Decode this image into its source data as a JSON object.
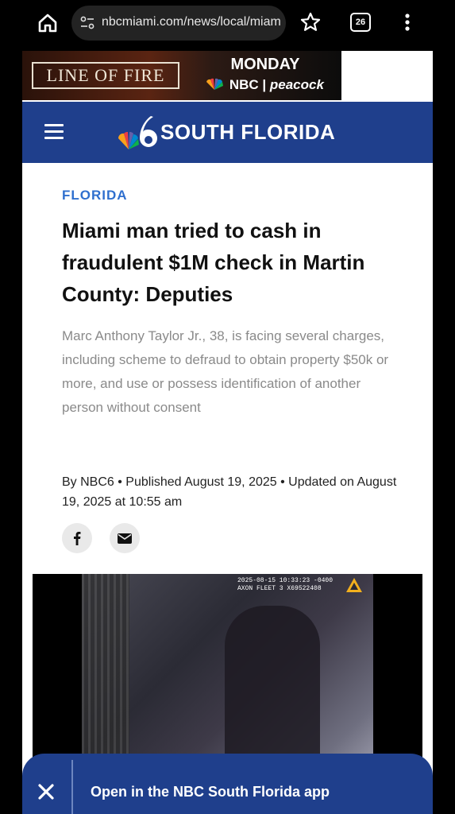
{
  "browser": {
    "url": "nbcmiami.com/news/local/miami",
    "tab_count": "26"
  },
  "ad": {
    "show_title": "LINE OF FIRE",
    "day": "MONDAY",
    "network": "NBC",
    "streaming": "peacock"
  },
  "site": {
    "brand": "SOUTH FLORIDA"
  },
  "article": {
    "category": "FLORIDA",
    "headline": "Miami man tried to cash in fraudulent $1M check in Martin County: Deputies",
    "subhead": "Marc Anthony Taylor Jr., 38, is facing several charges, including scheme to defraud to obtain property $50k or more, and use or possess identification of another person without consent",
    "byline": "By NBC6 • Published August 19, 2025 • Updated on August 19, 2025 at 10:55 am"
  },
  "video": {
    "timestamp": "2025-08-15 10:33:23 -0400\nAXON FLEET 3 X69522408"
  },
  "app_banner": {
    "cta": "Open in the NBC South Florida app"
  },
  "colors": {
    "brand_blue": "#1f3f8c",
    "category_blue": "#2f6fce"
  }
}
